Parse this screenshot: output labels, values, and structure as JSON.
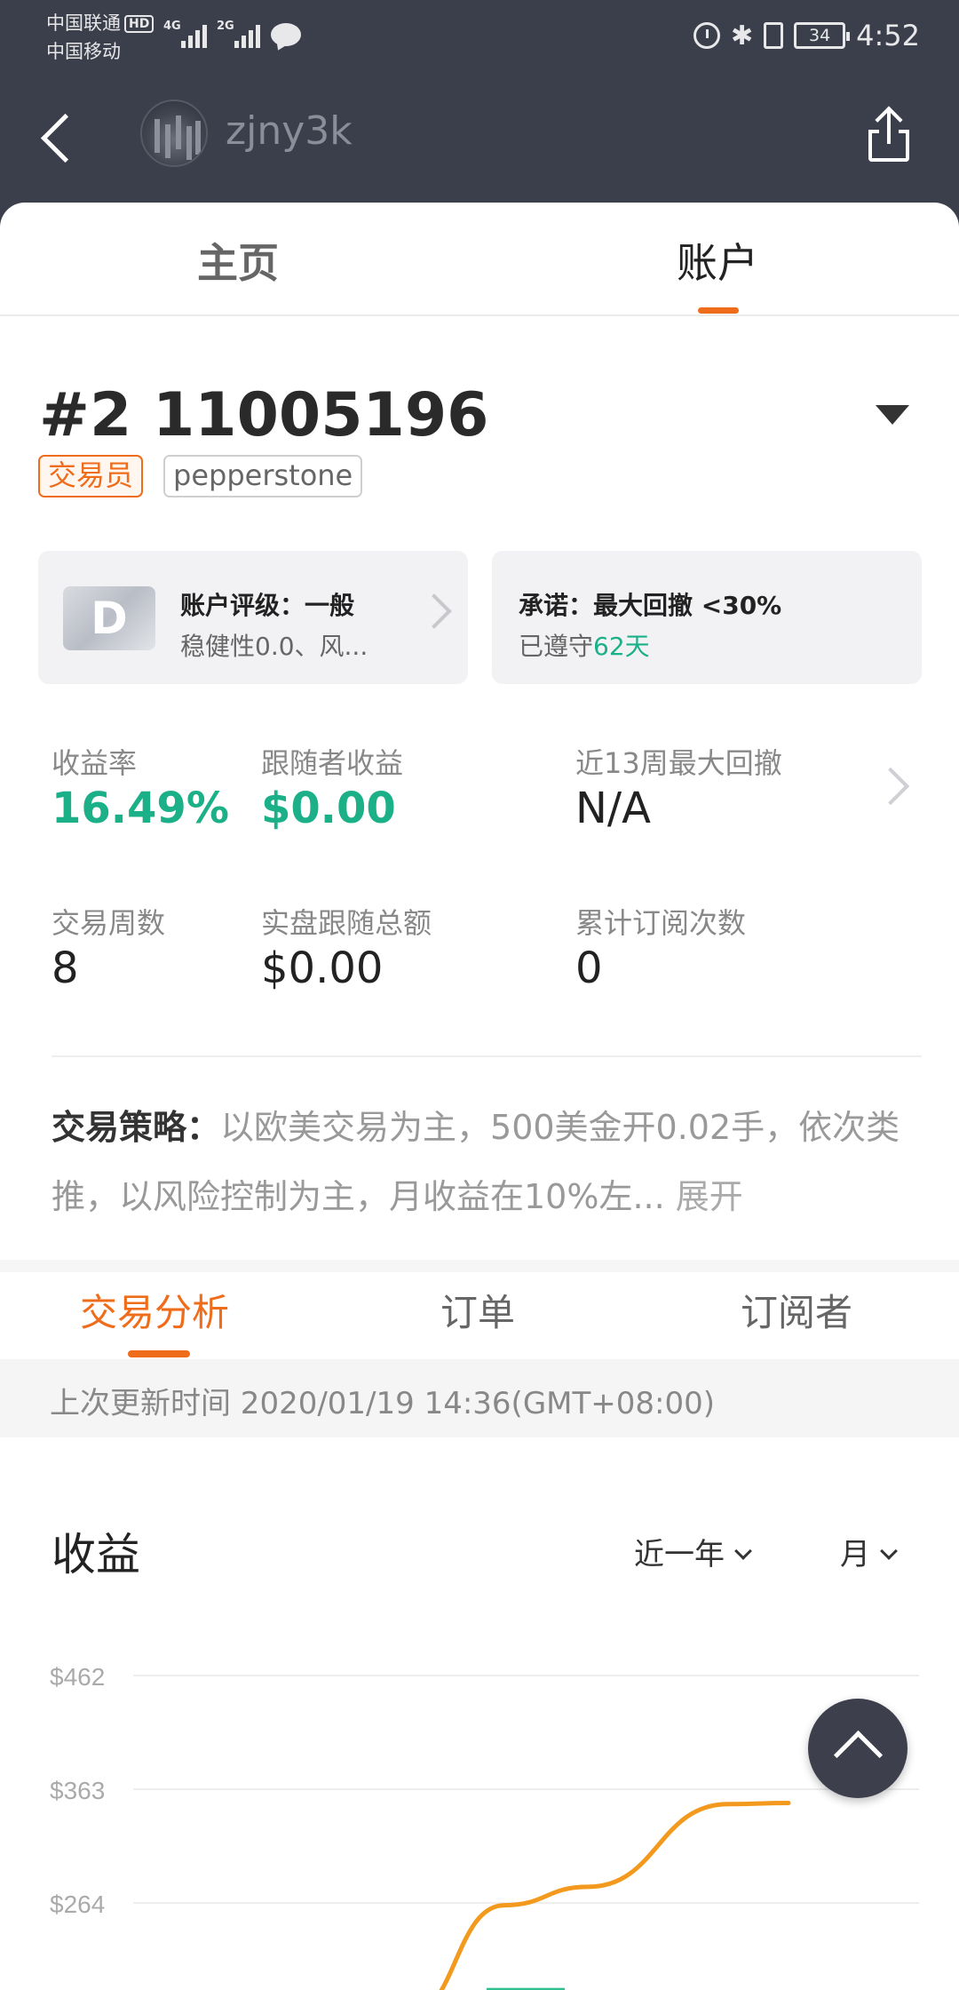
{
  "status_bar": {
    "carrier_1": "中国联通",
    "hd_badge": "HD",
    "carrier_2": "中国移动",
    "network_1": "4G",
    "network_2": "2G",
    "battery_level": "34",
    "time": "4:52"
  },
  "header": {
    "username": "zjny3k"
  },
  "main_tabs": [
    {
      "label": "主页",
      "active": false
    },
    {
      "label": "账户",
      "active": true
    }
  ],
  "account": {
    "id": "#2 11005196",
    "tags": [
      "交易员",
      "pepperstone"
    ]
  },
  "rating_card": {
    "grade": "D",
    "title": "账户评级：一般",
    "subtitle": "稳健性0.0、风..."
  },
  "promise_card": {
    "title": "承诺：最大回撤 <30%",
    "subtitle_prefix": "已遵守",
    "days": "62天"
  },
  "stats": [
    {
      "label": "收益率",
      "value": "16.49%",
      "highlight": true
    },
    {
      "label": "跟随者收益",
      "value": "$0.00",
      "highlight": true
    },
    {
      "label": "近13周最大回撤",
      "value": "N/A",
      "highlight": false
    },
    {
      "label": "交易周数",
      "value": "8",
      "highlight": false
    },
    {
      "label": "实盘跟随总额",
      "value": "$0.00",
      "highlight": false
    },
    {
      "label": "累计订阅次数",
      "value": "0",
      "highlight": false
    }
  ],
  "strategy": {
    "label": "交易策略：",
    "text": "以欧美交易为主，500美金开0.02手，依次类推，以风险控制为主，月收益在10%左...",
    "expand_label": "展开"
  },
  "sub_tabs": [
    {
      "label": "交易分析",
      "active": true
    },
    {
      "label": "订单",
      "active": false
    },
    {
      "label": "订阅者",
      "active": false
    }
  ],
  "update_info": "上次更新时间 2020/01/19 14:36(GMT+08:00)",
  "profit_section": {
    "title": "收益",
    "period_filter": "近一年",
    "granularity_filter": "月"
  },
  "colors": {
    "accent": "#ef6c1a",
    "positive": "#1bb087",
    "header_bg": "#3b3f4b",
    "bar": "#2fbf8f",
    "line": "#f39a1e"
  },
  "chart_data": {
    "type": "bar",
    "y_ticks": [
      "$462",
      "$363",
      "$264"
    ],
    "ylim": [
      165,
      462
    ],
    "bars": [
      {
        "value": 190
      }
    ],
    "series": [
      {
        "type": "line",
        "points": [
          {
            "x": 0,
            "y": 165
          },
          {
            "x": 1,
            "y": 262
          },
          {
            "x": 2,
            "y": 278
          },
          {
            "x": 3,
            "y": 350
          },
          {
            "x": 4,
            "y": 351
          }
        ]
      }
    ],
    "grid": true
  }
}
